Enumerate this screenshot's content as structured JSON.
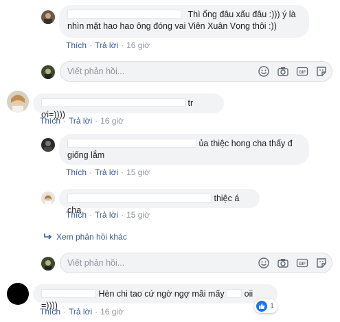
{
  "comments": [
    {
      "text_line1": "Thì ổng đâu xấu đâu :))) ý là",
      "text_line2": "nhìn mặt hao hao ông đóng vai Viên Xuân Vọng thôi :))",
      "like": "Thích",
      "reply": "Trả lời",
      "time": "16 giờ"
    },
    {
      "text": "tr ơi=))))",
      "like": "Thích",
      "reply": "Trả lời",
      "time": "16 giờ"
    },
    {
      "text_line1": "ủa thiệc hong cha thấy đ",
      "text_line2": "giống lắm",
      "like": "Thích",
      "reply": "Trả lời",
      "time": "15 giờ"
    },
    {
      "text": "thiệc á cha",
      "like": "Thích",
      "reply": "Trả lời",
      "time": "15 giờ"
    },
    {
      "text": "Hèn chi tao cứ ngờ ngợ mãi mấy",
      "text_tail": "oii =))))",
      "like": "Thích",
      "reply": "Trả lời",
      "time": "16 giờ",
      "reaction_count": "1"
    }
  ],
  "reply_box": {
    "placeholder": "Viết phản hồi..."
  },
  "more_replies": "Xem phản hồi khác",
  "colors": {
    "link": "#385898",
    "muted": "#90949c",
    "bubble": "#f2f3f5",
    "like_blue": "#1877f2"
  },
  "icons": [
    "emoji-icon",
    "camera-icon",
    "gif-icon",
    "sticker-icon",
    "reply-arrow-icon",
    "like-reaction-icon"
  ]
}
